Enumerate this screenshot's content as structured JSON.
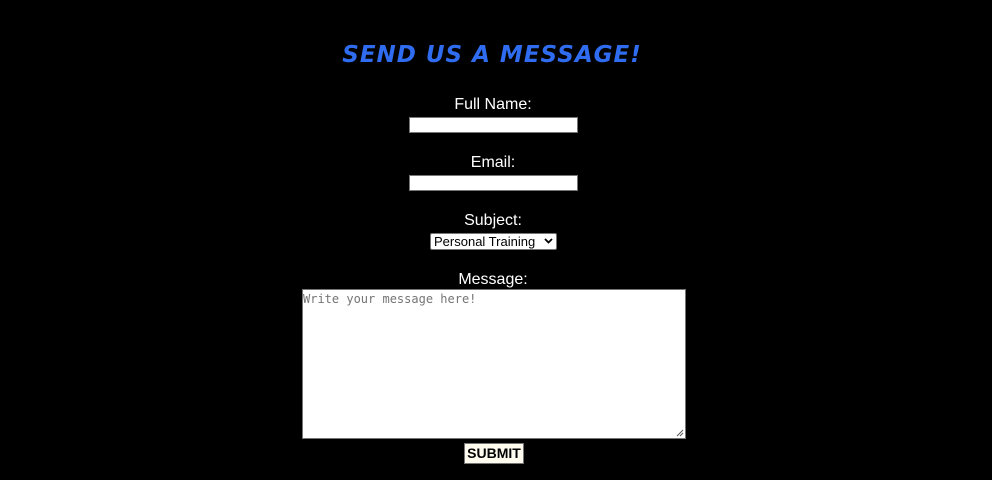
{
  "form": {
    "title": "Send us a message!",
    "full_name_label": "Full Name:",
    "full_name_value": "",
    "email_label": "Email:",
    "email_value": "",
    "subject_label": "Subject:",
    "subject_selected": "Personal Training",
    "message_label": "Message:",
    "message_placeholder": "Write your message here!",
    "submit_label": "SUBMIT"
  },
  "colors": {
    "background": "#000000",
    "title": "#2f6cf0",
    "label_text": "#ffffff",
    "button_bg": "#fffbee"
  },
  "icons": {
    "dropdown": "chevron-down-icon",
    "resize": "resize-handle-icon"
  }
}
